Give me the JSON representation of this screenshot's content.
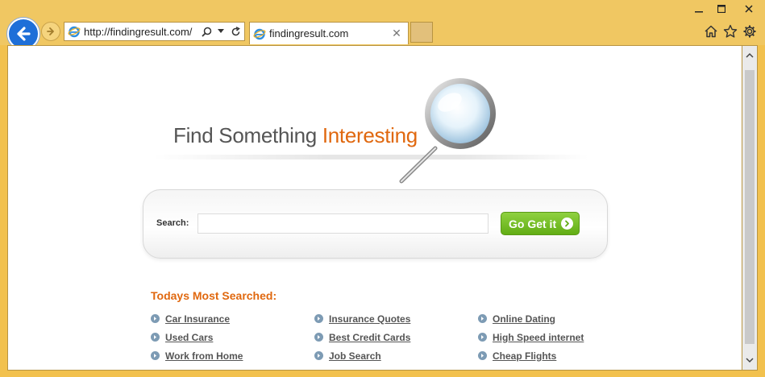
{
  "window": {
    "minimize_icon": "minimize-icon",
    "maximize_icon": "maximize-icon",
    "close_icon": "close-icon"
  },
  "browser": {
    "address": "http://findingresult.com/",
    "tab_title": "findingresult.com",
    "icons": [
      "back-icon",
      "forward-icon",
      "ie-icon",
      "search-icon",
      "dropdown-icon",
      "refresh-icon",
      "home-icon",
      "favorites-star-icon",
      "settings-gear-icon"
    ]
  },
  "page": {
    "headline_prefix": "Find Something ",
    "headline_accent": "Interesting",
    "search": {
      "label": "Search:",
      "value": "",
      "placeholder": "",
      "button_label": "Go Get it"
    },
    "popular": {
      "title": "Todays Most Searched:",
      "columns": [
        [
          "Car Insurance",
          "Used Cars",
          "Work from Home"
        ],
        [
          "Insurance Quotes",
          "Best Credit Cards",
          "Job Search"
        ],
        [
          "Online Dating",
          "High Speed internet",
          "Cheap Flights"
        ]
      ]
    }
  },
  "colors": {
    "accent": "#e0680f",
    "button_green": "#6fbb1c",
    "back_blue": "#1e6fd8",
    "chrome": "#f0c762"
  }
}
